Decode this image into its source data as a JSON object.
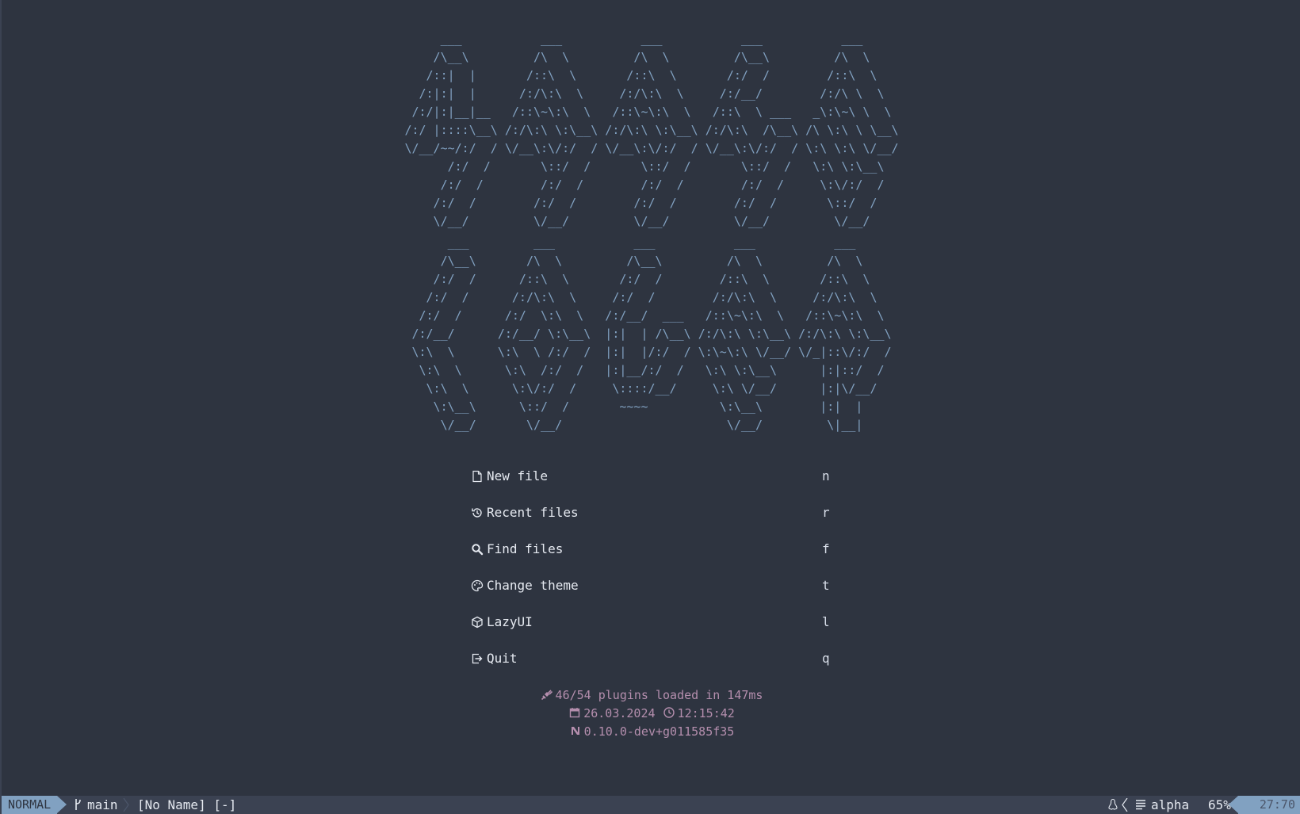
{
  "banner": {
    "top": "     ___           ___           ___           ___           ___     \n    /\\__\\         /\\  \\         /\\  \\         /\\__\\         /\\  \\    \n   /::|  |       /::\\  \\       /::\\  \\       /:/  /        /::\\  \\   \n  /:|:|  |      /:/\\:\\  \\     /:/\\:\\  \\     /:/__/        /:/\\ \\  \\  \n /:/|:|__|__   /::\\~\\:\\  \\   /::\\~\\:\\  \\   /::\\  \\ ___   _\\:\\~\\ \\  \\ \n/:/ |::::\\__\\ /:/\\:\\ \\:\\__\\ /:/\\:\\ \\:\\__\\ /:/\\:\\  /\\__\\ /\\ \\:\\ \\ \\__\\\n\\/__/~~/:/  / \\/__\\:\\/:/  / \\/__\\:\\/:/  / \\/__\\:\\/:/  / \\:\\ \\:\\ \\/__/\n      /:/  /       \\::/  /       \\::/  /       \\::/  /   \\:\\ \\:\\__\\  \n     /:/  /        /:/  /        /:/  /        /:/  /     \\:\\/:/  /  \n    /:/  /        /:/  /        /:/  /        /:/  /       \\::/  /   \n    \\/__/         \\/__/         \\/__/         \\/__/         \\/__/    ",
    "bottom": "     ___         ___           ___           ___           ___     \n    /\\__\\       /\\  \\         /\\__\\         /\\  \\         /\\  \\    \n   /:/  /      /::\\  \\       /:/  /        /::\\  \\       /::\\  \\   \n  /:/  /      /:/\\:\\  \\     /:/  /        /:/\\:\\  \\     /:/\\:\\  \\  \n /:/  /      /:/  \\:\\  \\   /:/__/  ___   /::\\~\\:\\  \\   /::\\~\\:\\  \\ \n/:/__/      /:/__/ \\:\\__\\  |:|  | /\\__\\ /:/\\:\\ \\:\\__\\ /:/\\:\\ \\:\\__\\\n\\:\\  \\      \\:\\  \\ /:/  /  |:|  |/:/  / \\:\\~\\:\\ \\/__/ \\/_|::\\/:/  /\n \\:\\  \\      \\:\\  /:/  /   |:|__/:/  /   \\:\\ \\:\\__\\      |:|::/  / \n  \\:\\  \\      \\:\\/:/  /     \\::::/__/     \\:\\ \\/__/      |:|\\/__/  \n   \\:\\__\\      \\::/  /       ~~~~          \\:\\__\\        |:|  |    \n    \\/__/       \\/__/                       \\/__/         \\|__|    "
  },
  "menu": {
    "items": [
      {
        "label": "New file",
        "key": "n",
        "icon": "file-icon"
      },
      {
        "label": "Recent files",
        "key": "r",
        "icon": "history-icon"
      },
      {
        "label": "Find files",
        "key": "f",
        "icon": "search-icon"
      },
      {
        "label": "Change theme",
        "key": "t",
        "icon": "palette-icon"
      },
      {
        "label": "LazyUI",
        "key": "l",
        "icon": "package-icon"
      },
      {
        "label": "Quit",
        "key": "q",
        "icon": "exit-icon"
      }
    ]
  },
  "footer": {
    "plugins": "46/54 plugins loaded in 147ms",
    "date": "26.03.2024",
    "time": "12:15:42",
    "version": "0.10.0-dev+g011585f35"
  },
  "statusline": {
    "mode": "NORMAL",
    "branch": "main",
    "filename": "[No Name] [-]",
    "filetype": "alpha",
    "percent": "65%",
    "position": "27:70"
  },
  "colors": {
    "background": "#2e3440",
    "statusline_bg": "#3b4252",
    "accent": "#81a1c1",
    "text": "#e5e9f0",
    "footer": "#b48ead"
  }
}
